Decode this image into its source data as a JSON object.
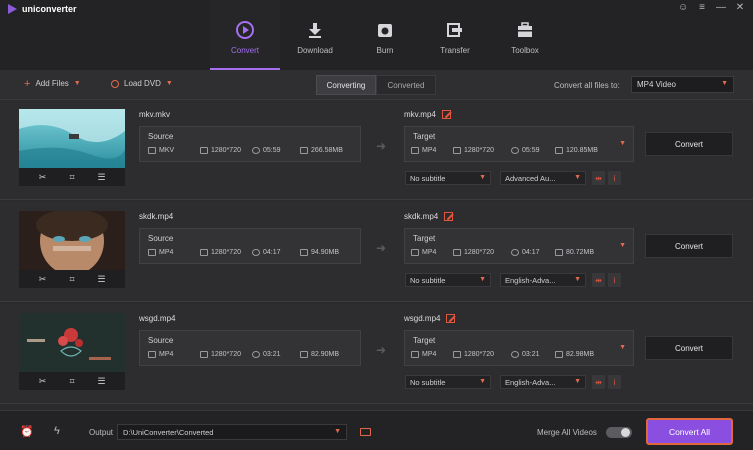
{
  "app": {
    "name": "uniconverter"
  },
  "window_controls": [
    "☺",
    "≡",
    "—",
    "✕"
  ],
  "nav": [
    {
      "label": "Convert",
      "icon": "convert-icon",
      "active": true
    },
    {
      "label": "Download",
      "icon": "download-icon",
      "active": false
    },
    {
      "label": "Burn",
      "icon": "burn-icon",
      "active": false
    },
    {
      "label": "Transfer",
      "icon": "transfer-icon",
      "active": false
    },
    {
      "label": "Toolbox",
      "icon": "toolbox-icon",
      "active": false
    }
  ],
  "toolbar": {
    "add_files": "Add Files",
    "load_dvd": "Load DVD",
    "tab_converting": "Converting",
    "tab_converted": "Converted",
    "convert_all_to": "Convert all files to:",
    "format": "MP4 Video"
  },
  "files": [
    {
      "source_name": "mkv.mkv",
      "source_label": "Source",
      "source_format": "MKV",
      "source_res": "1280*720",
      "source_dur": "05:59",
      "source_size": "266.58MB",
      "target_name": "mkv.mp4",
      "target_label": "Target",
      "target_format": "MP4",
      "target_res": "1280*720",
      "target_dur": "05:59",
      "target_size": "120.85MB",
      "subtitle": "No subtitle",
      "audio": "Advanced Au...",
      "convert_label": "Convert"
    },
    {
      "source_name": "skdk.mp4",
      "source_label": "Source",
      "source_format": "MP4",
      "source_res": "1280*720",
      "source_dur": "04:17",
      "source_size": "94.90MB",
      "target_name": "skdk.mp4",
      "target_label": "Target",
      "target_format": "MP4",
      "target_res": "1280*720",
      "target_dur": "04:17",
      "target_size": "80.72MB",
      "subtitle": "No subtitle",
      "audio": "English-Adva...",
      "convert_label": "Convert"
    },
    {
      "source_name": "wsgd.mp4",
      "source_label": "Source",
      "source_format": "MP4",
      "source_res": "1280*720",
      "source_dur": "03:21",
      "source_size": "82.90MB",
      "target_name": "wsgd.mp4",
      "target_label": "Target",
      "target_format": "MP4",
      "target_res": "1280*720",
      "target_dur": "03:21",
      "target_size": "82.98MB",
      "subtitle": "No subtitle",
      "audio": "English-Adva...",
      "convert_label": "Convert"
    }
  ],
  "bottom": {
    "output_label": "Output",
    "output_path": "D:\\UniConverter\\Converted",
    "merge_label": "Merge All Videos",
    "convert_all": "Convert All"
  },
  "colors": {
    "accent": "#a56ff0",
    "accent_orange": "#e06a4e",
    "button_purple": "#8a4fe0"
  }
}
